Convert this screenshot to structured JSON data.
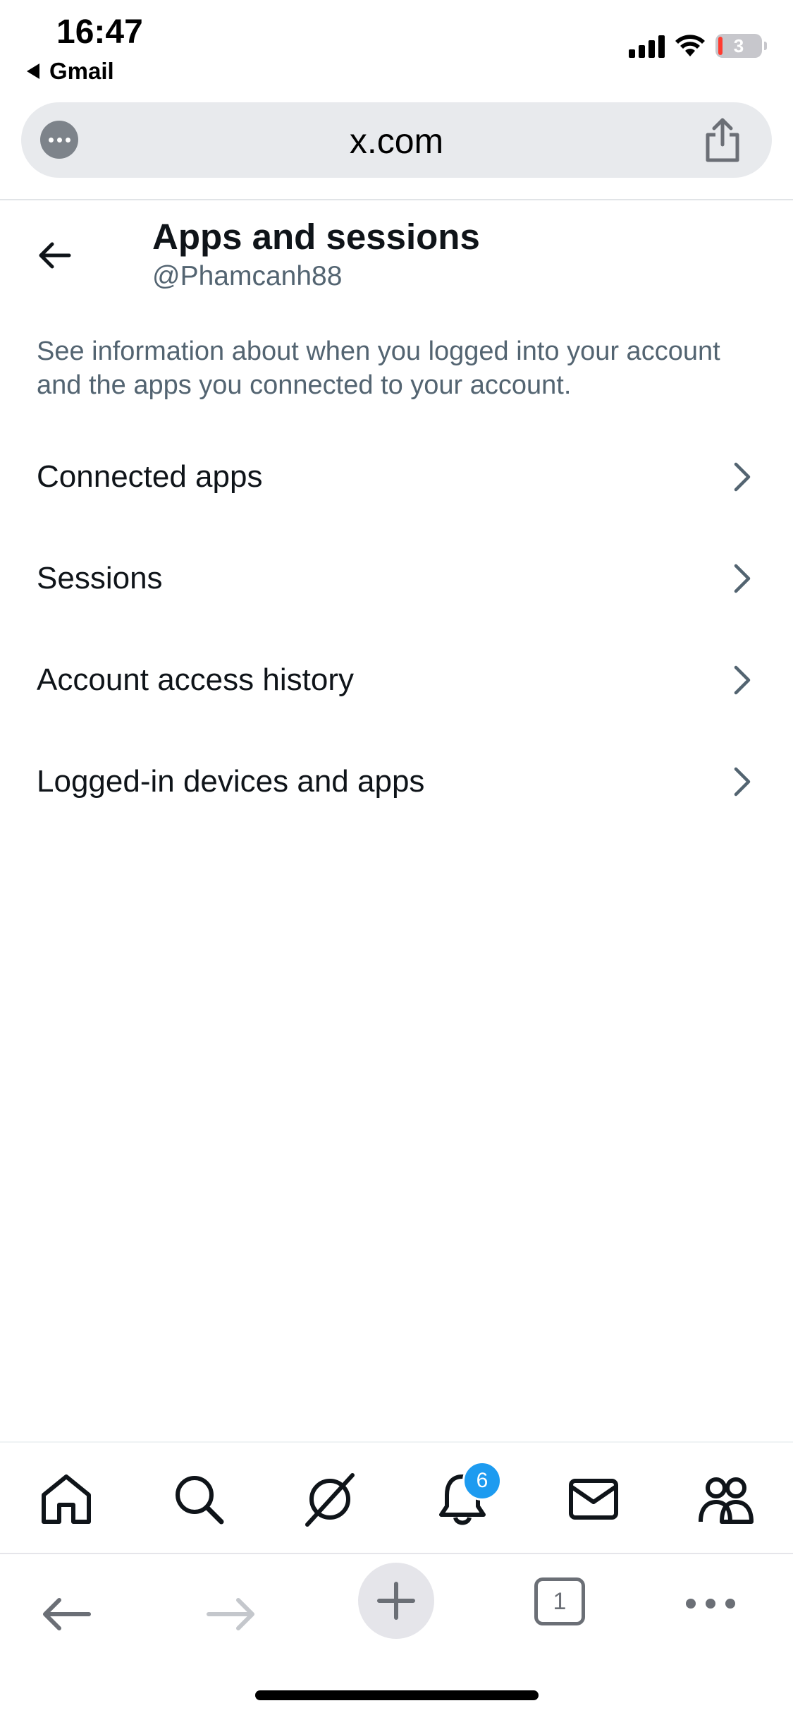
{
  "status_bar": {
    "time": "16:47",
    "back_app": "Gmail",
    "battery": "3"
  },
  "url_bar": {
    "url": "x.com"
  },
  "header": {
    "title": "Apps and sessions",
    "handle": "@Phamcanh88"
  },
  "description": "See information about when you logged into your account and the apps you connected to your account.",
  "menu": {
    "items": [
      {
        "label": "Connected apps"
      },
      {
        "label": "Sessions"
      },
      {
        "label": "Account access history"
      },
      {
        "label": "Logged-in devices and apps"
      }
    ]
  },
  "bottom_nav": {
    "items": [
      "home-icon",
      "search-icon",
      "grok-icon",
      "notifications-icon",
      "messages-icon",
      "communities-icon"
    ],
    "notifications_badge": "6"
  },
  "browser_toolbar": {
    "tab_count": "1"
  },
  "colors": {
    "text": "#0f1419",
    "secondary": "#536471",
    "accent": "#1d9bf0"
  }
}
